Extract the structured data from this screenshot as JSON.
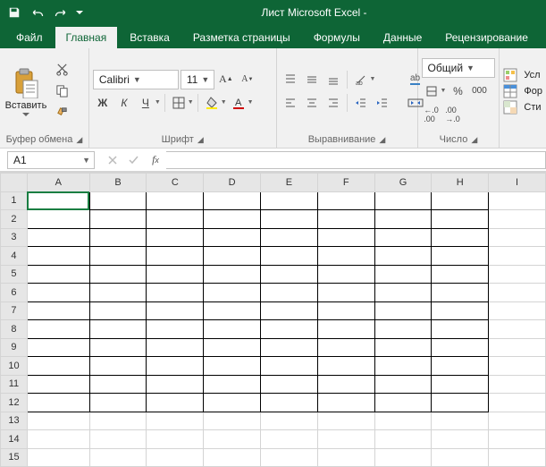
{
  "titlebar": {
    "title": "Лист Microsoft Excel -"
  },
  "tabs": {
    "file": "Файл",
    "home": "Главная",
    "insert": "Вставка",
    "pagelayout": "Разметка страницы",
    "formulas": "Формулы",
    "data": "Данные",
    "review": "Рецензирование"
  },
  "ribbon": {
    "clipboard": {
      "paste": "Вставить",
      "label": "Буфер обмена"
    },
    "font": {
      "name": "Calibri",
      "size": "11",
      "bold": "Ж",
      "italic": "К",
      "underline": "Ч",
      "label": "Шрифт"
    },
    "alignment": {
      "wrap": "ab",
      "label": "Выравнивание"
    },
    "number": {
      "format": "Общий",
      "label": "Число"
    },
    "styles": {
      "cond": "Усл",
      "table": "Фор",
      "cell": "Сти"
    }
  },
  "fxbar": {
    "namebox": "A1",
    "formula": ""
  },
  "grid": {
    "cols": [
      "A",
      "B",
      "C",
      "D",
      "E",
      "F",
      "G",
      "H",
      "I"
    ],
    "rows": [
      "1",
      "2",
      "3",
      "4",
      "5",
      "6",
      "7",
      "8",
      "9",
      "10",
      "11",
      "12",
      "13",
      "14",
      "15"
    ],
    "selected": "A1"
  }
}
